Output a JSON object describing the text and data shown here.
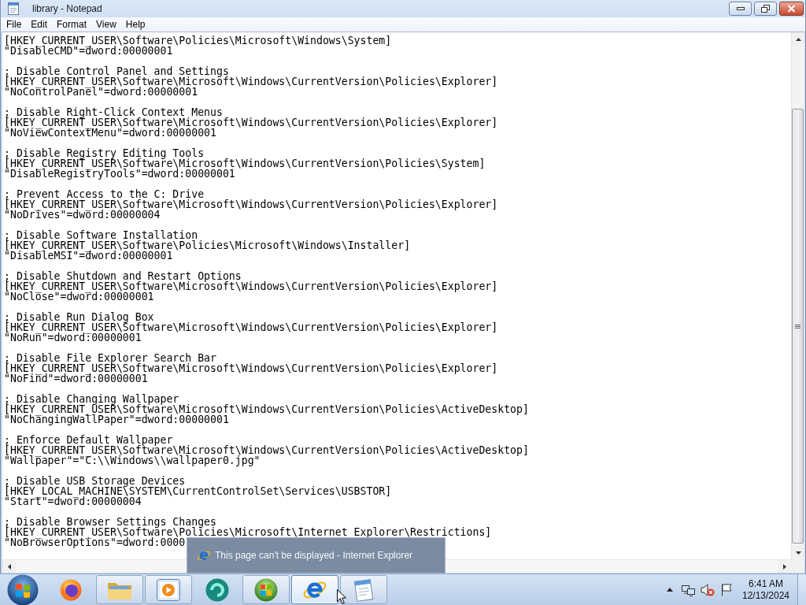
{
  "window": {
    "title": "library - Notepad"
  },
  "menu_bar": {
    "items": [
      "File",
      "Edit",
      "Format",
      "View",
      "Help"
    ]
  },
  "document": {
    "blocks": [
      {
        "lines": [
          "[HKEY_CURRENT_USER\\Software\\Policies\\Microsoft\\Windows\\System]",
          "\"DisableCMD\"=dword:00000001"
        ]
      },
      {
        "lines": [
          "; Disable Control Panel and Settings",
          "[HKEY_CURRENT_USER\\Software\\Microsoft\\Windows\\CurrentVersion\\Policies\\Explorer]",
          "\"NoControlPanel\"=dword:00000001"
        ]
      },
      {
        "lines": [
          "; Disable Right-Click Context Menus",
          "[HKEY_CURRENT_USER\\Software\\Microsoft\\Windows\\CurrentVersion\\Policies\\Explorer]",
          "\"NoViewContextMenu\"=dword:00000001"
        ]
      },
      {
        "lines": [
          "; Disable Registry Editing Tools",
          "[HKEY_CURRENT_USER\\Software\\Microsoft\\Windows\\CurrentVersion\\Policies\\System]",
          "\"DisableRegistryTools\"=dword:00000001"
        ]
      },
      {
        "lines": [
          "; Prevent Access to the C: Drive",
          "[HKEY_CURRENT_USER\\Software\\Microsoft\\Windows\\CurrentVersion\\Policies\\Explorer]",
          "\"NoDrives\"=dword:00000004"
        ]
      },
      {
        "lines": [
          "; Disable Software Installation",
          "[HKEY_CURRENT_USER\\Software\\Policies\\Microsoft\\Windows\\Installer]",
          "\"DisableMSI\"=dword:00000001"
        ]
      },
      {
        "lines": [
          "; Disable Shutdown and Restart Options",
          "[HKEY_CURRENT_USER\\Software\\Microsoft\\Windows\\CurrentVersion\\Policies\\Explorer]",
          "\"NoClose\"=dword:00000001"
        ]
      },
      {
        "lines": [
          "; Disable Run Dialog Box",
          "[HKEY_CURRENT_USER\\Software\\Microsoft\\Windows\\CurrentVersion\\Policies\\Explorer]",
          "\"NoRun\"=dword:00000001"
        ]
      },
      {
        "lines": [
          "; Disable File Explorer Search Bar",
          "[HKEY_CURRENT_USER\\Software\\Microsoft\\Windows\\CurrentVersion\\Policies\\Explorer]",
          "\"NoFind\"=dword:00000001"
        ]
      },
      {
        "lines": [
          "; Disable Changing Wallpaper",
          "[HKEY_CURRENT_USER\\Software\\Microsoft\\Windows\\CurrentVersion\\Policies\\ActiveDesktop]",
          "\"NoChangingWallPaper\"=dword:00000001"
        ]
      },
      {
        "lines": [
          "; Enforce Default Wallpaper",
          "[HKEY_CURRENT_USER\\Software\\Microsoft\\Windows\\CurrentVersion\\Policies\\ActiveDesktop]",
          "\"Wallpaper\"=\"C:\\\\Windows\\\\wallpaper0.jpg\""
        ]
      },
      {
        "lines": [
          "; Disable USB Storage Devices",
          "[HKEY_LOCAL_MACHINE\\SYSTEM\\CurrentControlSet\\Services\\USBSTOR]",
          "\"Start\"=dword:00000004"
        ]
      },
      {
        "lines": [
          "; Disable Browser Settings Changes",
          "[HKEY_CURRENT_USER\\Software\\Policies\\Microsoft\\Internet Explorer\\Restrictions]",
          "\"NoBrowserOptions\"=dword:0000"
        ]
      }
    ]
  },
  "preview_tooltip": {
    "title": "This page can't be displayed - Internet Explorer"
  },
  "taskbar": {
    "buttons": [
      {
        "kind": "globe",
        "running": false,
        "hovered": false
      },
      {
        "kind": "folder",
        "running": true,
        "hovered": false
      },
      {
        "kind": "player",
        "running": true,
        "hovered": false
      },
      {
        "kind": "swirl",
        "running": false,
        "hovered": false
      },
      {
        "kind": "orb",
        "running": true,
        "hovered": false
      },
      {
        "kind": "ie",
        "running": true,
        "hovered": true
      },
      {
        "kind": "notepad",
        "running": true,
        "hovered": false
      }
    ],
    "clock": {
      "time": "6:41 AM",
      "date": "12/13/2024"
    }
  }
}
